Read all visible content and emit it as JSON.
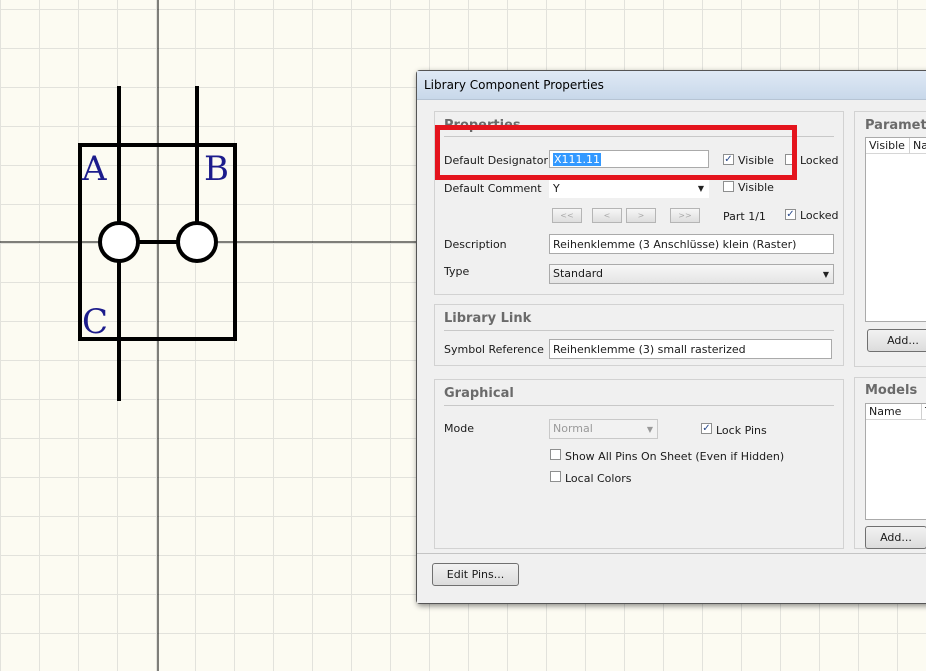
{
  "schematic": {
    "pins": [
      {
        "label": "A"
      },
      {
        "label": "B"
      },
      {
        "label": "C"
      }
    ]
  },
  "dialog": {
    "title": "Library Component Properties",
    "properties": {
      "group_title": "Properties",
      "default_designator_label": "Default Designator",
      "default_designator_value": "X111.11",
      "visible_label": "Visible",
      "designator_visible": true,
      "locked_label": "Locked",
      "designator_locked": false,
      "default_comment_label": "Default Comment",
      "default_comment_value": "Y",
      "comment_visible": false,
      "nav_first": "<<",
      "nav_prev": "<",
      "nav_next": ">",
      "nav_last": ">>",
      "part_label": "Part 1/1",
      "part_locked": true,
      "description_label": "Description",
      "description_value": "Reihenklemme (3 Anschlüsse) klein (Raster)",
      "type_label": "Type",
      "type_value": "Standard"
    },
    "library_link": {
      "group_title": "Library Link",
      "symbol_reference_label": "Symbol Reference",
      "symbol_reference_value": "Reihenklemme (3) small rasterized"
    },
    "graphical": {
      "group_title": "Graphical",
      "mode_label": "Mode",
      "mode_value": "Normal",
      "lock_pins_label": "Lock Pins",
      "lock_pins": true,
      "show_all_pins_label": "Show All Pins On Sheet (Even if Hidden)",
      "show_all_pins": false,
      "local_colors_label": "Local Colors",
      "local_colors": false
    },
    "parameters": {
      "group_title": "Parameters",
      "columns": [
        "Visible",
        "Na"
      ],
      "add_button": "Add..."
    },
    "models": {
      "group_title": "Models",
      "columns": [
        "Name",
        "T"
      ],
      "add_button": "Add..."
    },
    "edit_pins_button": "Edit Pins..."
  },
  "colors": {
    "highlight": "#e4141d",
    "pin_label": "#1c1c8c",
    "selection": "#3399ff"
  }
}
